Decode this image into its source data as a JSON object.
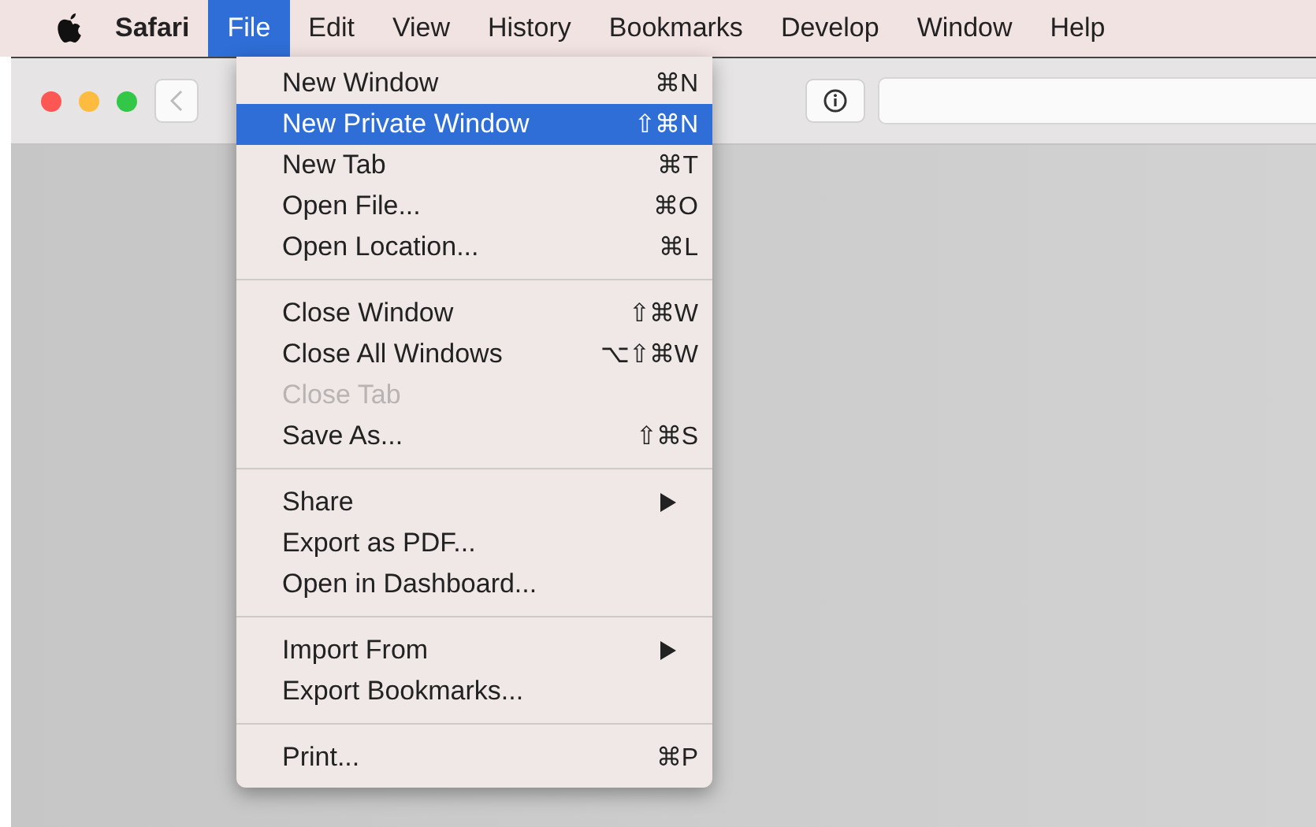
{
  "menu_bar": {
    "items": [
      {
        "label": "Safari",
        "kind": "app",
        "selected": false
      },
      {
        "label": "File",
        "kind": "menu",
        "selected": true
      },
      {
        "label": "Edit",
        "kind": "menu",
        "selected": false
      },
      {
        "label": "View",
        "kind": "menu",
        "selected": false
      },
      {
        "label": "History",
        "kind": "menu",
        "selected": false
      },
      {
        "label": "Bookmarks",
        "kind": "menu",
        "selected": false
      },
      {
        "label": "Develop",
        "kind": "menu",
        "selected": false
      },
      {
        "label": "Window",
        "kind": "menu",
        "selected": false
      },
      {
        "label": "Help",
        "kind": "menu",
        "selected": false
      }
    ]
  },
  "file_menu": {
    "sections": [
      [
        {
          "label": "New Window",
          "shortcut": "⌘N",
          "selected": false,
          "disabled": false
        },
        {
          "label": "New Private Window",
          "shortcut": "⇧⌘N",
          "selected": true,
          "disabled": false
        },
        {
          "label": "New Tab",
          "shortcut": "⌘T",
          "selected": false,
          "disabled": false
        },
        {
          "label": "Open File...",
          "shortcut": "⌘O",
          "selected": false,
          "disabled": false
        },
        {
          "label": "Open Location...",
          "shortcut": "⌘L",
          "selected": false,
          "disabled": false
        }
      ],
      [
        {
          "label": "Close Window",
          "shortcut": "⇧⌘W",
          "selected": false,
          "disabled": false
        },
        {
          "label": "Close All Windows",
          "shortcut": "⌥⇧⌘W",
          "selected": false,
          "disabled": false
        },
        {
          "label": "Close Tab",
          "selected": false,
          "disabled": true
        },
        {
          "label": "Save As...",
          "shortcut": "⇧⌘S",
          "selected": false,
          "disabled": false
        }
      ],
      [
        {
          "label": "Share",
          "submenu": true,
          "selected": false,
          "disabled": false
        },
        {
          "label": "Export as PDF...",
          "selected": false,
          "disabled": false
        },
        {
          "label": "Open in Dashboard...",
          "selected": false,
          "disabled": false
        }
      ],
      [
        {
          "label": "Import From",
          "submenu": true,
          "selected": false,
          "disabled": false
        },
        {
          "label": "Export Bookmarks...",
          "selected": false,
          "disabled": false
        }
      ],
      [
        {
          "label": "Print...",
          "shortcut": "⌘P",
          "selected": false,
          "disabled": false
        }
      ]
    ]
  }
}
